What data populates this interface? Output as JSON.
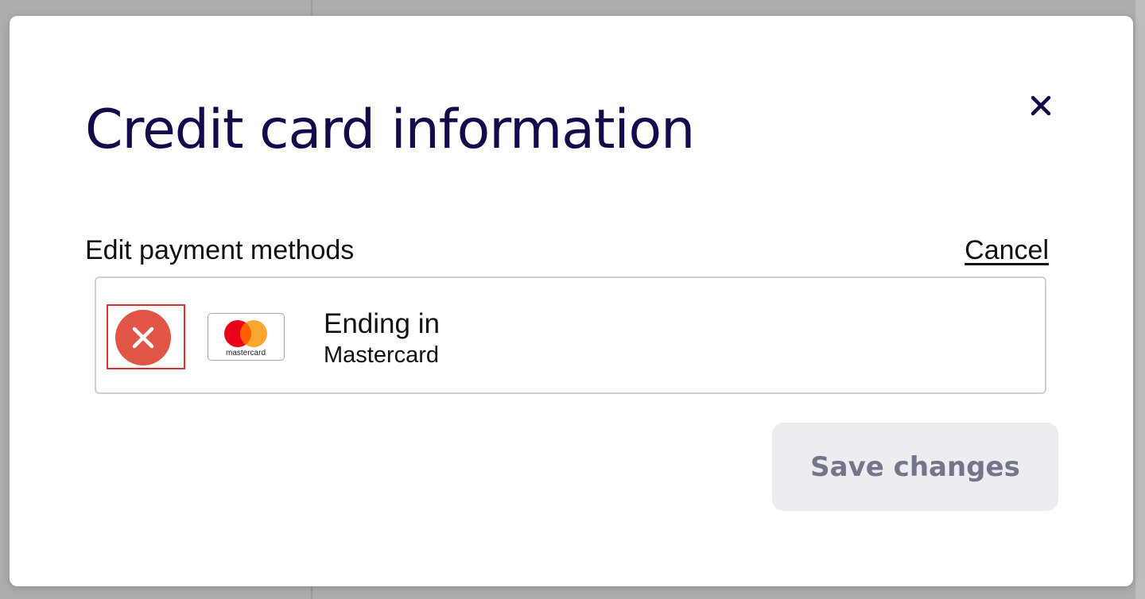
{
  "modal": {
    "title": "Credit card information",
    "close_icon": "close-icon"
  },
  "payment_methods": {
    "heading": "Edit payment methods",
    "cancel_label": "Cancel",
    "cards": [
      {
        "line1": "Ending in",
        "brand": "Mastercard",
        "logo_text": "mastercard",
        "remove_icon": "remove-circle-x-icon"
      }
    ]
  },
  "actions": {
    "save_label": "Save changes",
    "save_enabled": false
  },
  "colors": {
    "title": "#140a4b",
    "remove_button": "#e05545",
    "highlight_border": "#e0302a",
    "mastercard_red": "#eb001b",
    "mastercard_orange": "#f79e1b",
    "save_button_bg": "#ecedf1",
    "save_button_text": "#74748a"
  }
}
